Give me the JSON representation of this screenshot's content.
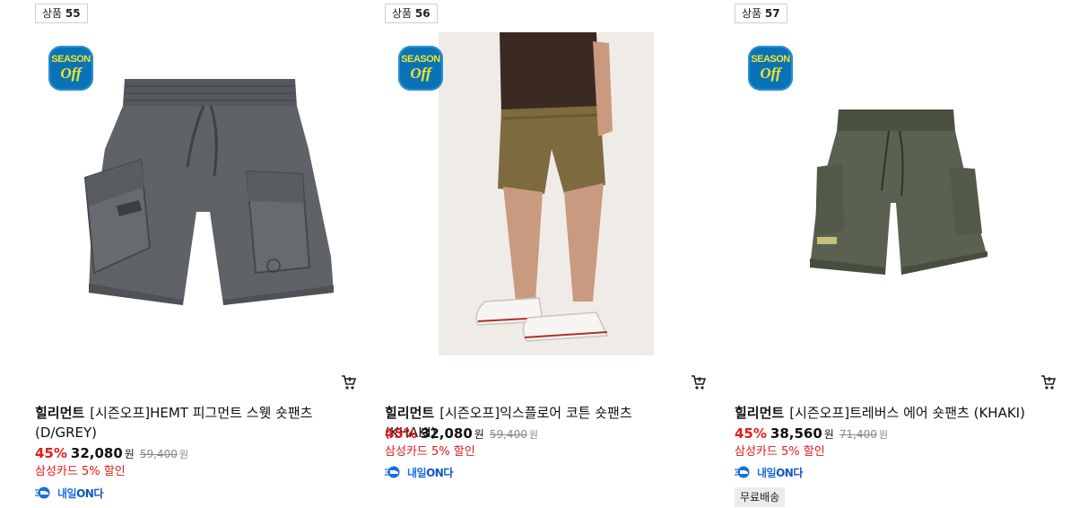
{
  "products": [
    {
      "badge_prefix": "상품",
      "badge_num": "55",
      "season_line1": "SEASON",
      "season_line2": "Off",
      "brand": "힐리먼트",
      "name": "[시즌오프]HEMT 피그먼트 스웻 숏팬츠 (D/GREY)",
      "discount": "45%",
      "price": "32,080",
      "currency": "원",
      "original_price": "59,400",
      "card_discount": "삼성카드 5% 할인",
      "delivery_1": "내일",
      "delivery_2": "ON다",
      "image_desc": "grey sweat shorts"
    },
    {
      "badge_prefix": "상품",
      "badge_num": "56",
      "season_line1": "SEASON",
      "season_line2": "Off",
      "brand": "힐리먼트",
      "name": "[시즌오프]익스플로어 코튼 숏팬츠 (KHAKI)",
      "discount": "45%",
      "price": "32,080",
      "currency": "원",
      "original_price": "59,400",
      "card_discount": "삼성카드 5% 할인",
      "delivery_1": "내일",
      "delivery_2": "ON다",
      "image_desc": "model wearing khaki shorts"
    },
    {
      "badge_prefix": "상품",
      "badge_num": "57",
      "season_line1": "SEASON",
      "season_line2": "Off",
      "brand": "힐리먼트",
      "name": "[시즌오프]트레버스 에어 숏팬츠 (KHAKI)",
      "discount": "45%",
      "price": "38,560",
      "currency": "원",
      "original_price": "71,400",
      "card_discount": "삼성카드 5% 할인",
      "delivery_1": "내일",
      "delivery_2": "ON다",
      "free_shipping": "무료배송",
      "image_desc": "khaki nylon shorts"
    }
  ],
  "colors": {
    "discount_red": "#e41b1b",
    "season_badge_blue": "#0a73b8",
    "season_text_yellow": "#f3e628",
    "delivery_blue": "#1a6fe0"
  },
  "icons": {
    "cart": "cart-icon",
    "delivery": "delivery-truck-icon"
  }
}
